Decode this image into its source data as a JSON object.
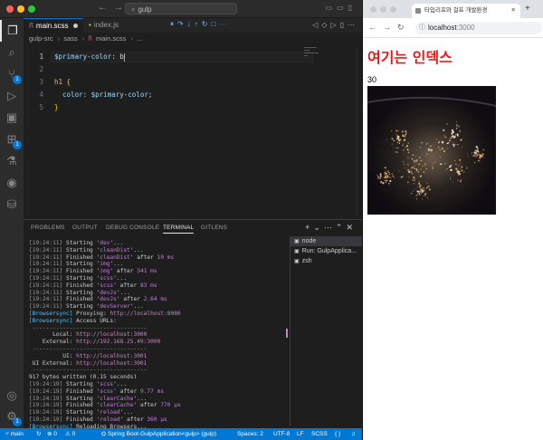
{
  "vscode": {
    "search_box": "gulp",
    "tabs": [
      {
        "label": "main.scss",
        "modified": true
      },
      {
        "label": "index.js",
        "modified": false
      }
    ],
    "breadcrumb": [
      "gulp-src",
      "sass",
      "main.scss",
      "..."
    ],
    "code_lines": [
      {
        "num": "1",
        "parts": [
          {
            "t": "$primary-color",
            "c": "var"
          },
          {
            "t": ": b",
            "c": "plain"
          }
        ]
      },
      {
        "num": "2",
        "parts": []
      },
      {
        "num": "3",
        "parts": [
          {
            "t": "h1",
            "c": "sel"
          },
          {
            "t": " {",
            "c": "brace"
          }
        ]
      },
      {
        "num": "4",
        "parts": [
          {
            "t": "  color",
            "c": "prop"
          },
          {
            "t": ": ",
            "c": "plain"
          },
          {
            "t": "$primary-color",
            "c": "var"
          },
          {
            "t": ";",
            "c": "plain"
          }
        ]
      },
      {
        "num": "5",
        "parts": [
          {
            "t": "}",
            "c": "brace"
          }
        ]
      }
    ],
    "activity_badges": {
      "source_control": "1",
      "extensions": "1",
      "settings": "1"
    },
    "panel_tabs": [
      "PROBLEMS",
      "OUTPUT",
      "DEBUG CONSOLE",
      "TERMINAL",
      "GITLENS"
    ],
    "active_panel_tab": "TERMINAL",
    "terminal_lines": [
      [
        {
          "t": "[19:24:11] ",
          "c": "ts"
        },
        {
          "t": "Starting '",
          "c": ""
        },
        {
          "t": "dev",
          "c": "mag"
        },
        {
          "t": "'...",
          "c": ""
        }
      ],
      [
        {
          "t": "[19:24:11] ",
          "c": "ts"
        },
        {
          "t": "Starting '",
          "c": ""
        },
        {
          "t": "cleanDist",
          "c": "mag"
        },
        {
          "t": "'...",
          "c": ""
        }
      ],
      [
        {
          "t": "[19:24:11] ",
          "c": "ts"
        },
        {
          "t": "Finished '",
          "c": ""
        },
        {
          "t": "cleanDist",
          "c": "mag"
        },
        {
          "t": "' after ",
          "c": ""
        },
        {
          "t": "10 ms",
          "c": "mag"
        }
      ],
      [
        {
          "t": "[19:24:11] ",
          "c": "ts"
        },
        {
          "t": "Starting '",
          "c": ""
        },
        {
          "t": "img",
          "c": "mag"
        },
        {
          "t": "'...",
          "c": ""
        }
      ],
      [
        {
          "t": "[19:24:11] ",
          "c": "ts"
        },
        {
          "t": "Finished '",
          "c": ""
        },
        {
          "t": "img",
          "c": "mag"
        },
        {
          "t": "' after ",
          "c": ""
        },
        {
          "t": "341 ms",
          "c": "mag"
        }
      ],
      [
        {
          "t": "[19:24:11] ",
          "c": "ts"
        },
        {
          "t": "Starting '",
          "c": ""
        },
        {
          "t": "scss",
          "c": "mag"
        },
        {
          "t": "'...",
          "c": ""
        }
      ],
      [
        {
          "t": "[19:24:11] ",
          "c": "ts"
        },
        {
          "t": "Finished '",
          "c": ""
        },
        {
          "t": "scss",
          "c": "mag"
        },
        {
          "t": "' after ",
          "c": ""
        },
        {
          "t": "83 ms",
          "c": "mag"
        }
      ],
      [
        {
          "t": "[19:24:11] ",
          "c": "ts"
        },
        {
          "t": "Starting '",
          "c": ""
        },
        {
          "t": "devJs",
          "c": "mag"
        },
        {
          "t": "'...",
          "c": ""
        }
      ],
      [
        {
          "t": "[19:24:11] ",
          "c": "ts"
        },
        {
          "t": "Finished '",
          "c": ""
        },
        {
          "t": "devJs",
          "c": "mag"
        },
        {
          "t": "' after ",
          "c": ""
        },
        {
          "t": "2.64 ms",
          "c": "mag"
        }
      ],
      [
        {
          "t": "[19:24:11] ",
          "c": "ts"
        },
        {
          "t": "Starting '",
          "c": ""
        },
        {
          "t": "devServer",
          "c": "mag"
        },
        {
          "t": "'...",
          "c": ""
        }
      ],
      [
        {
          "t": "[Browsersync] ",
          "c": "bs"
        },
        {
          "t": "Proxying: ",
          "c": ""
        },
        {
          "t": "http://localhost:8080",
          "c": "url"
        }
      ],
      [
        {
          "t": "[Browsersync] ",
          "c": "bs"
        },
        {
          "t": "Access URLs:",
          "c": ""
        }
      ],
      [
        {
          "t": " ----------------------------------",
          "c": "ts"
        }
      ],
      [
        {
          "t": "       Local: ",
          "c": ""
        },
        {
          "t": "http://localhost:3000",
          "c": "url"
        }
      ],
      [
        {
          "t": "    External: ",
          "c": ""
        },
        {
          "t": "http://192.168.25.49:3000",
          "c": "url"
        }
      ],
      [
        {
          "t": " ----------------------------------",
          "c": "ts"
        }
      ],
      [
        {
          "t": "          UI: ",
          "c": ""
        },
        {
          "t": "http://localhost:3001",
          "c": "url"
        }
      ],
      [
        {
          "t": " UI External: ",
          "c": ""
        },
        {
          "t": "http://localhost:3001",
          "c": "url"
        }
      ],
      [
        {
          "t": " ----------------------------------",
          "c": "ts"
        }
      ],
      [
        {
          "t": "917 bytes written (0.15 seconds)",
          "c": ""
        }
      ],
      [
        {
          "t": "[19:24:19] ",
          "c": "ts"
        },
        {
          "t": "Starting '",
          "c": ""
        },
        {
          "t": "scss",
          "c": "mag"
        },
        {
          "t": "'...",
          "c": ""
        }
      ],
      [
        {
          "t": "[19:24:19] ",
          "c": "ts"
        },
        {
          "t": "Finished '",
          "c": ""
        },
        {
          "t": "scss",
          "c": "mag"
        },
        {
          "t": "' after ",
          "c": ""
        },
        {
          "t": "9.77 ms",
          "c": "mag"
        }
      ],
      [
        {
          "t": "[19:24:19] ",
          "c": "ts"
        },
        {
          "t": "Starting '",
          "c": ""
        },
        {
          "t": "clearCache",
          "c": "mag"
        },
        {
          "t": "'...",
          "c": ""
        }
      ],
      [
        {
          "t": "[19:24:19] ",
          "c": "ts"
        },
        {
          "t": "Finished '",
          "c": ""
        },
        {
          "t": "clearCache",
          "c": "mag"
        },
        {
          "t": "' after ",
          "c": ""
        },
        {
          "t": "770 μs",
          "c": "mag"
        }
      ],
      [
        {
          "t": "[19:24:19] ",
          "c": "ts"
        },
        {
          "t": "Starting '",
          "c": ""
        },
        {
          "t": "reload",
          "c": "mag"
        },
        {
          "t": "'...",
          "c": ""
        }
      ],
      [
        {
          "t": "[19:24:19] ",
          "c": "ts"
        },
        {
          "t": "Finished '",
          "c": ""
        },
        {
          "t": "reload",
          "c": "mag"
        },
        {
          "t": "' after ",
          "c": ""
        },
        {
          "t": "360 μs",
          "c": "mag"
        }
      ],
      [
        {
          "t": "[Browsersync] ",
          "c": "bs"
        },
        {
          "t": "Reloading Browsers...",
          "c": ""
        }
      ],
      [
        {
          "t": "▯",
          "c": ""
        }
      ]
    ],
    "terminal_list": [
      {
        "label": "node",
        "selected": true
      },
      {
        "label": "Run: GulpApplica...",
        "selected": false
      },
      {
        "label": "zsh",
        "selected": false
      }
    ],
    "status": {
      "branch": "main",
      "sync": "↻",
      "errors": "⊗ 0",
      "warnings": "⚠ 0",
      "run_config": "Spring Boot-GulpApplication<gulp> (gulp)",
      "spaces": "Spaces: 2",
      "encoding": "UTF-8",
      "eol": "LF",
      "language": "SCSS"
    },
    "colors": {
      "accent": "#0078d4",
      "status_bg": "#0078d4",
      "heading_red": "#e31c1c"
    }
  },
  "browser": {
    "tab_title": "타입리프와 걸프 개발환경",
    "url_host": "localhost",
    "url_port": ":3000",
    "page_heading": "여기는 인덱스",
    "page_number": "30"
  }
}
